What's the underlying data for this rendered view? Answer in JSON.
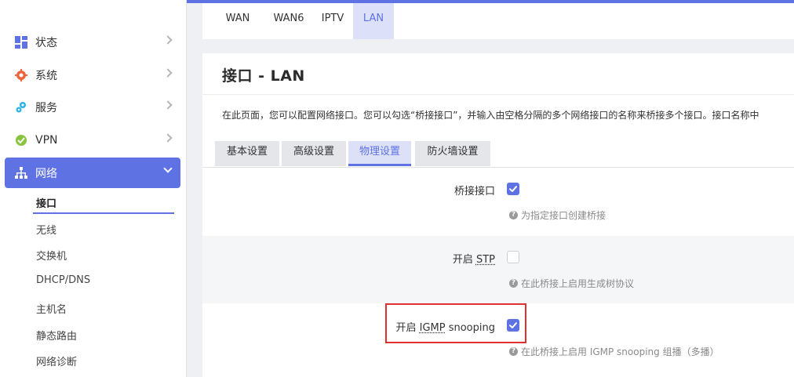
{
  "sidebar": {
    "items": [
      {
        "label": "状态",
        "icon": "dashboard-icon"
      },
      {
        "label": "系统",
        "icon": "gear-icon"
      },
      {
        "label": "服务",
        "icon": "services-icon"
      },
      {
        "label": "VPN",
        "icon": "vpn-icon"
      },
      {
        "label": "网络",
        "icon": "network-icon"
      }
    ],
    "subitems": [
      "接口",
      "无线",
      "交换机",
      "DHCP/DNS",
      "主机名",
      "静态路由",
      "网络诊断"
    ]
  },
  "top_tabs": [
    "WAN",
    "WAN6",
    "IPTV",
    "LAN"
  ],
  "page": {
    "title": "接口 - LAN",
    "description": "在此页面，您可以配置网络接口。您可以勾选“桥接接口”，并输入由空格分隔的多个网络接口的名称来桥接多个接口。接口名称中"
  },
  "sub_tabs": [
    "基本设置",
    "高级设置",
    "物理设置",
    "防火墙设置"
  ],
  "fields": {
    "bridge": {
      "label": "桥接接口",
      "checked": true,
      "hint": "为指定接口创建桥接"
    },
    "stp": {
      "label_prefix": "开启 ",
      "label_abbr": "STP",
      "checked": false,
      "hint": "在此桥接上启用生成树协议"
    },
    "igmp": {
      "label_prefix": "开启 ",
      "label_abbr": "IGMP",
      "label_suffix": " snooping",
      "checked": true,
      "hint": "在此桥接上启用 IGMP snooping 组播（多播）"
    }
  },
  "colors": {
    "accent": "#5e72e4",
    "highlight": "#e03030"
  }
}
